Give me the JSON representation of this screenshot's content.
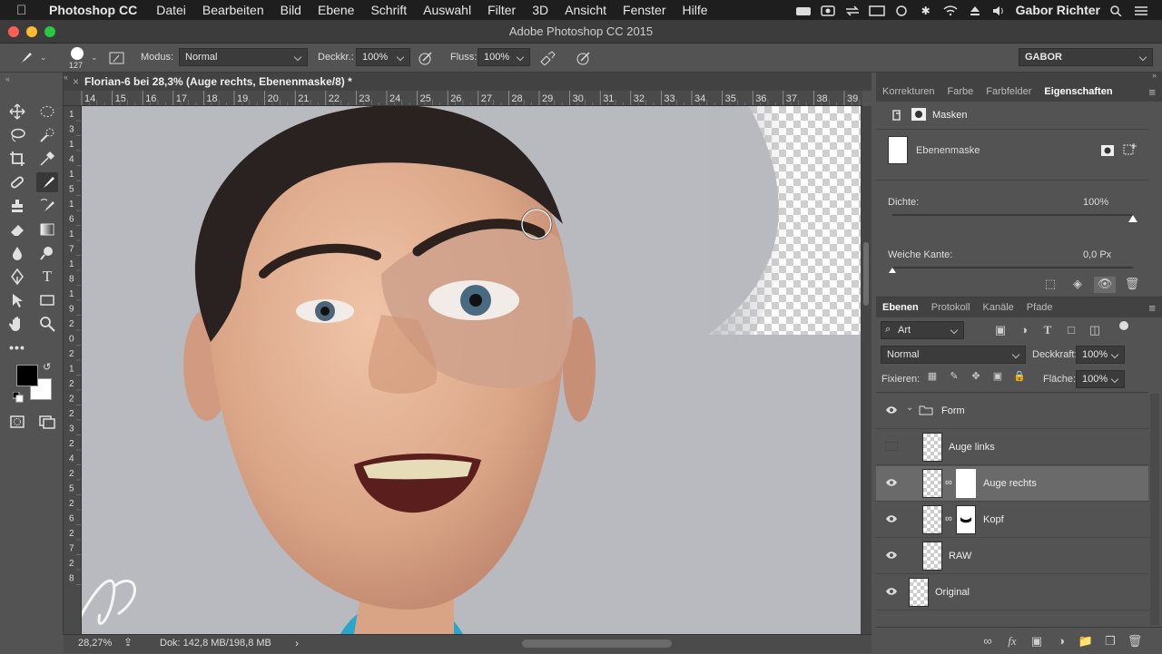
{
  "mac_menu": {
    "app": "Photoshop CC",
    "items": [
      "Datei",
      "Bearbeiten",
      "Bild",
      "Ebene",
      "Schrift",
      "Auswahl",
      "Filter",
      "3D",
      "Ansicht",
      "Fenster",
      "Hilfe"
    ],
    "user": "Gabor Richter"
  },
  "window": {
    "title": "Adobe Photoshop CC 2015"
  },
  "options": {
    "brush_size": "127",
    "mode_label": "Modus:",
    "mode_value": "Normal",
    "opacity_label": "Deckkr.:",
    "opacity_value": "100%",
    "flow_label": "Fluss:",
    "flow_value": "100%",
    "workspace": "GABOR"
  },
  "document": {
    "tab_title": "Florian-6 bei 28,3% (Auge rechts, Ebenenmaske/8) *",
    "ruler_h": [
      "14",
      "15",
      "16",
      "17",
      "18",
      "19",
      "20",
      "21",
      "22",
      "23",
      "24",
      "25",
      "26",
      "27",
      "28",
      "29",
      "30",
      "31",
      "32",
      "33",
      "34",
      "35",
      "36",
      "37",
      "38",
      "39"
    ],
    "ruler_v": [
      "1",
      "3",
      "1",
      "4",
      "1",
      "5",
      "1",
      "6",
      "1",
      "7",
      "1",
      "8",
      "1",
      "9",
      "2",
      "0",
      "2",
      "1",
      "2",
      "2",
      "2",
      "3",
      "2",
      "4",
      "2",
      "5",
      "2",
      "6",
      "2",
      "7",
      "2",
      "8"
    ],
    "zoom": "28,27%",
    "doc_size": "Dok: 142,8 MB/198,8 MB"
  },
  "properties_panel": {
    "tabs": [
      "Korrekturen",
      "Farbe",
      "Farbfelder",
      "Eigenschaften"
    ],
    "active_tab": "Eigenschaften",
    "header": "Masken",
    "mask_label": "Ebenenmaske",
    "density_label": "Dichte:",
    "density_value": "100%",
    "density_fraction": 1.0,
    "feather_label": "Weiche Kante:",
    "feather_value": "0,0 Px",
    "feather_fraction": 0.0
  },
  "layers_panel": {
    "tabs": [
      "Ebenen",
      "Protokoll",
      "Kanäle",
      "Pfade"
    ],
    "active_tab": "Ebenen",
    "filter_value": "Art",
    "blend_mode": "Normal",
    "opacity_label": "Deckkraft:",
    "opacity_value": "100%",
    "lock_label": "Fixieren:",
    "fill_label": "Fläche:",
    "fill_value": "100%",
    "layers": [
      {
        "name": "Form",
        "type": "group",
        "visible": true,
        "selected": false
      },
      {
        "name": "Auge links",
        "type": "layer",
        "visible": false,
        "selected": false,
        "mask": false
      },
      {
        "name": "Auge rechts",
        "type": "layer",
        "visible": true,
        "selected": true,
        "mask": true
      },
      {
        "name": "Kopf",
        "type": "layer",
        "visible": true,
        "selected": false,
        "mask": true
      },
      {
        "name": "RAW",
        "type": "layer",
        "visible": true,
        "selected": false,
        "mask": false
      },
      {
        "name": "Original",
        "type": "layer",
        "visible": true,
        "selected": false,
        "mask": false
      }
    ]
  },
  "colors": {
    "foreground": "#000000",
    "background": "#ffffff",
    "selection": "#6a6a6a"
  }
}
